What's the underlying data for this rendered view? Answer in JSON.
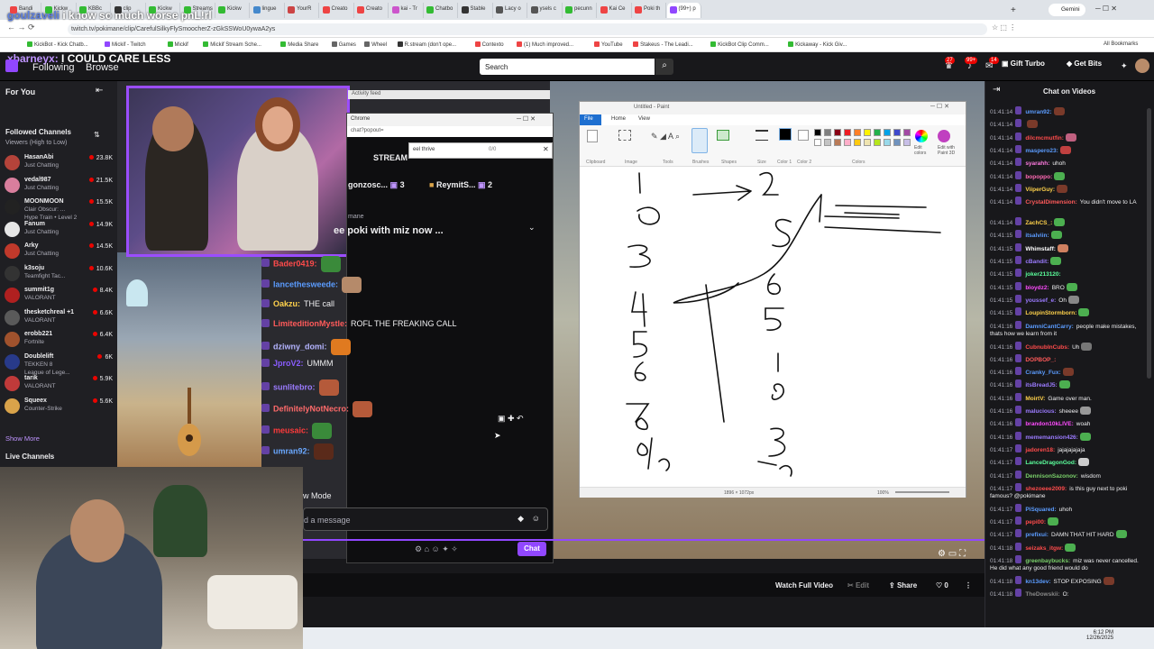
{
  "browser": {
    "tabs": [
      "Bandi",
      "Kickw",
      "KBBc",
      "clip",
      "Kickw",
      "Streams",
      "Kickw",
      "lingue",
      "YourR",
      "Creato",
      "Creato",
      "kai - Tr",
      "Chatbo",
      "Stable",
      "Lacy o",
      "ysels c",
      "pecunn",
      "Kai Ce",
      "Poki th",
      "(99+) p"
    ],
    "active_tab": "(99+) p",
    "new_tab": "+",
    "profile_label": "Gemini",
    "url": "twitch.tv/pokimane/clip/CarefulSilkyFlySmoocherZ-zGkSSWoU0ywaA2ys",
    "bookmarks": [
      "KickBot - Kick Chatb...",
      "Mickif - Twitch",
      "Mickif",
      "Mickif Stream Sche...",
      "Media Share",
      "Games",
      "Wheel",
      "R.stream (don't ope...",
      "Contexto",
      "(1) Much improved...",
      "YouTube",
      "Stakeus - The Leadi...",
      "KickBot Clip Comm...",
      "Kickaway - Kick Giv..."
    ],
    "all_bookmarks": "All Bookmarks"
  },
  "overlay": {
    "name": "goulzaveli",
    "message": "i know so much worse pnL!rl"
  },
  "nav": {
    "user": "xbarneyx:",
    "user_msg": "I COULD CARE LESS",
    "following": "Following",
    "browse": "Browse",
    "search_placeholder": "Search",
    "badge_notifications": "27",
    "badge_whispers": "99+",
    "badge_inbox": "14",
    "gift_turbo": "Gift Turbo",
    "get_bits": "Get Bits"
  },
  "sidebar": {
    "for_you": "For You",
    "followed_title": "Followed Channels",
    "followed_sub": "Viewers (High to Low)",
    "channels": [
      {
        "name": "HasanAbi",
        "game": "Just Chatting",
        "viewers": "23.8K",
        "color": "#b4433a"
      },
      {
        "name": "vedal987",
        "game": "Just Chatting",
        "viewers": "21.5K",
        "color": "#d97e9d"
      },
      {
        "name": "MOONMOON",
        "game": "Clair Obscur: ...",
        "viewers": "15.5K",
        "color": "#222222"
      },
      {
        "name": "Fanum",
        "game": "Just Chatting",
        "viewers": "14.9K",
        "color": "#e6e6e6"
      },
      {
        "name": "Arky",
        "game": "Just Chatting",
        "viewers": "14.5K",
        "color": "#c0392b"
      },
      {
        "name": "k3soju",
        "game": "Teamfight Tac...",
        "viewers": "10.6K",
        "color": "#333333"
      },
      {
        "name": "summit1g",
        "game": "VALORANT",
        "viewers": "8.4K",
        "color": "#b02020"
      },
      {
        "name": "thesketchreal +1",
        "game": "VALORANT",
        "viewers": "6.6K",
        "color": "#5a5a5a"
      },
      {
        "name": "erobb221",
        "game": "Fortnite",
        "viewers": "6.4K",
        "color": "#a0522d"
      },
      {
        "name": "Doublelift",
        "game": "TEKKEN 8",
        "viewers": "6K",
        "color": "#283a8a"
      },
      {
        "name": "tarik",
        "game": "VALORANT",
        "viewers": "5.9K",
        "color": "#c03a3a"
      },
      {
        "name": "Squeex",
        "game": "Counter-Strike",
        "viewers": "5.6K",
        "color": "#d9a34a"
      }
    ],
    "moonmoon_extra": "Hype Train • Level 2",
    "doublelift_extra": "League of Lege...",
    "show_more": "Show More",
    "live_channels": "Live Channels"
  },
  "popout": {
    "activity_feed": "Activity feed",
    "window_title": "Chrome",
    "url": "chat?popout=",
    "find_text": "eel thrive",
    "find_count": "0/0",
    "streamer_label": "STREAM",
    "gifter1": "gonzosc...",
    "gifter1_count": "3",
    "gifter2": "ReymitS...",
    "gifter2_count": "2",
    "game_label": "mane",
    "stream_title": "ee poki with miz now ...",
    "messages": [
      {
        "user": "Bader0419:",
        "text": "",
        "color": "#ff4b4b"
      },
      {
        "user": "lancethesweede:",
        "text": "",
        "color": "#5b9cff"
      },
      {
        "user": "Oakzu:",
        "text": "THE call",
        "color": "#ffd24b"
      },
      {
        "user": "LimiteditionMystle:",
        "text": "ROFL THE FREAKING CALL",
        "color": "#ff5a5a"
      },
      {
        "user": "dziwny_domi:",
        "text": "",
        "color": "#b4b4ff"
      },
      {
        "user": "JproV2:",
        "text": "UMMM",
        "color": "#8a5cff"
      },
      {
        "user": "sunlitebro:",
        "text": "",
        "color": "#9b7bff"
      },
      {
        "user": "DefinitelyNotNecro:",
        "text": "",
        "color": "#ff6a6a"
      },
      {
        "user": "meusaic:",
        "text": "",
        "color": "#ff3b3b"
      },
      {
        "user": "umran92:",
        "text": "",
        "color": "#6aa8ff"
      }
    ],
    "chat_mode": "w Mode",
    "input_placeholder": "d a message",
    "chat_button": "Chat"
  },
  "paint": {
    "title": "Untitled - Paint",
    "menu_file": "File",
    "menu_home": "Home",
    "menu_view": "View",
    "ribbon_labels": [
      "Clipboard",
      "Image",
      "Tools",
      "Brushes",
      "Shapes",
      "Size",
      "Color 1",
      "Color 2",
      "Colors"
    ],
    "edit_colors": "Edit colors",
    "edit_paint3d": "Edit with Paint 3D",
    "palette": [
      "#000000",
      "#7f7f7f",
      "#880015",
      "#ed1c24",
      "#ff7f27",
      "#fff200",
      "#22b14c",
      "#00a2e8",
      "#3f48cc",
      "#a349a4",
      "#ffffff",
      "#c3c3c3",
      "#b97a57",
      "#ffaec9",
      "#ffc90e",
      "#efe4b0",
      "#b5e61d",
      "#99d9ea",
      "#7092be",
      "#c8bfe7"
    ],
    "canvas_size": "1896 × 1072px",
    "zoom": "100%"
  },
  "chat": {
    "title": "Chat on Videos",
    "messages": [
      {
        "t": "01:41:14",
        "u": "umran92:",
        "m": "",
        "c": "#5b9cff",
        "e": "#7a3a2a"
      },
      {
        "t": "01:41:14",
        "u": "",
        "m": "",
        "c": "#9b7bff",
        "e": "#7a3a2a"
      },
      {
        "t": "01:41:14",
        "u": "dilcmcmutfin:",
        "m": "",
        "c": "#ff4b4b",
        "e": "#c06080"
      },
      {
        "t": "01:41:14",
        "u": "maspero23:",
        "m": "",
        "c": "#5b9cff",
        "e": "#c04040"
      },
      {
        "t": "01:41:14",
        "u": "syarahh:",
        "m": "uhoh",
        "c": "#ff7ae0",
        "e": ""
      },
      {
        "t": "01:41:14",
        "u": "bopoppo:",
        "m": "",
        "c": "#ff69b4",
        "e": "#4caf50"
      },
      {
        "t": "01:41:14",
        "u": "ViiperGuy:",
        "m": "",
        "c": "#ffd24b",
        "e": "#7a3a2a"
      },
      {
        "t": "01:41:14",
        "u": "CrystalDimension:",
        "m": "You didn't move to LA",
        "c": "#ff5a5a",
        "e": ""
      },
      {
        "t": "01:41:14",
        "u": "ZachCS_:",
        "m": "",
        "c": "#ffd24b",
        "e": "#4caf50"
      },
      {
        "t": "01:41:15",
        "u": "itsalviin:",
        "m": "",
        "c": "#5b9cff",
        "e": "#4caf50"
      },
      {
        "t": "01:41:15",
        "u": "Whimstaff:",
        "m": "",
        "c": "#ffffff",
        "e": "#d08060"
      },
      {
        "t": "01:41:15",
        "u": "cBandit:",
        "m": "",
        "c": "#9b7bff",
        "e": "#4caf50"
      },
      {
        "t": "01:41:15",
        "u": "joker213120:",
        "m": "",
        "c": "#5bff9c",
        "e": ""
      },
      {
        "t": "01:41:15",
        "u": "bloydz2:",
        "m": "BRO",
        "c": "#ff4bff",
        "e": "#4caf50"
      },
      {
        "t": "01:41:15",
        "u": "youssef_e:",
        "m": "Oh",
        "c": "#9b7bff",
        "e": "#888888"
      },
      {
        "t": "01:41:15",
        "u": "LoupinStormborn:",
        "m": "",
        "c": "#ffd24b",
        "e": "#4caf50"
      },
      {
        "t": "01:41:16",
        "u": "DamniCantCarry:",
        "m": "people make mistakes, thats how we learn from it",
        "c": "#5b9cff",
        "e": ""
      },
      {
        "t": "01:41:16",
        "u": "CubnubInCubs:",
        "m": "Uh",
        "c": "#ff4b4b",
        "e": "#777777"
      },
      {
        "t": "01:41:16",
        "u": "DOPBOP_:",
        "m": "",
        "c": "#ff5a5a",
        "e": ""
      },
      {
        "t": "01:41:16",
        "u": "Cranky_Fux:",
        "m": "",
        "c": "#5b9cff",
        "e": "#7a3a2a"
      },
      {
        "t": "01:41:16",
        "u": "itsBreadJ5:",
        "m": "",
        "c": "#9b7bff",
        "e": "#4caf50"
      },
      {
        "t": "01:41:16",
        "u": "MoirtV:",
        "m": "Game over man.",
        "c": "#ffd24b",
        "e": ""
      },
      {
        "t": "01:41:16",
        "u": "malucious:",
        "m": "sheeee",
        "c": "#9b7bff",
        "e": "#999999"
      },
      {
        "t": "01:41:16",
        "u": "brandon10kLIVE:",
        "m": "woah",
        "c": "#ff4bff",
        "e": ""
      },
      {
        "t": "01:41:16",
        "u": "mememansion426:",
        "m": "",
        "c": "#9b7bff",
        "e": "#4caf50"
      },
      {
        "t": "01:41:17",
        "u": "jadoren18:",
        "m": "jajajajajaja",
        "c": "#ff4b4b",
        "e": ""
      },
      {
        "t": "01:41:17",
        "u": "LanceDragonGod:",
        "m": "",
        "c": "#5bff9c",
        "e": "#cccccc"
      },
      {
        "t": "01:41:17",
        "u": "DennisonSazonov:",
        "m": "wisdom",
        "c": "#7ad06a",
        "e": ""
      },
      {
        "t": "01:41:17",
        "u": "shezoeee2009:",
        "m": "is this guy next to poki famous? @pokimane",
        "c": "#ff4b4b",
        "e": ""
      },
      {
        "t": "01:41:17",
        "u": "PiSquared:",
        "m": "uhoh",
        "c": "#5b9cff",
        "e": ""
      },
      {
        "t": "01:41:17",
        "u": "pepi00:",
        "m": "",
        "c": "#ff4b4b",
        "e": "#4caf50"
      },
      {
        "t": "01:41:17",
        "u": "prefixui:",
        "m": "DAMN THAT HIT HARD",
        "c": "#5b9cff",
        "e": "#4caf50"
      },
      {
        "t": "01:41:18",
        "u": "seizaks_itgw:",
        "m": "",
        "c": "#ff4b4b",
        "e": "#4caf50"
      },
      {
        "t": "01:41:18",
        "u": "greenbaybucks:",
        "m": "miz was never cancelled. He did what any good friend would do",
        "c": "#7ad06a",
        "e": ""
      },
      {
        "t": "01:41:18",
        "u": "kn13dev:",
        "m": "STOP EXPOSING",
        "c": "#5b9cff",
        "e": "#7a3a2a"
      },
      {
        "t": "01:41:18",
        "u": "TheDowskii:",
        "m": "O:",
        "c": "#888888",
        "e": ""
      }
    ]
  },
  "bottom": {
    "watch_full": "Watch Full Video",
    "edit": "Edit",
    "share": "Share",
    "likes": "0"
  },
  "clock": {
    "time": "6:12 PM",
    "date": "12/26/2025"
  }
}
